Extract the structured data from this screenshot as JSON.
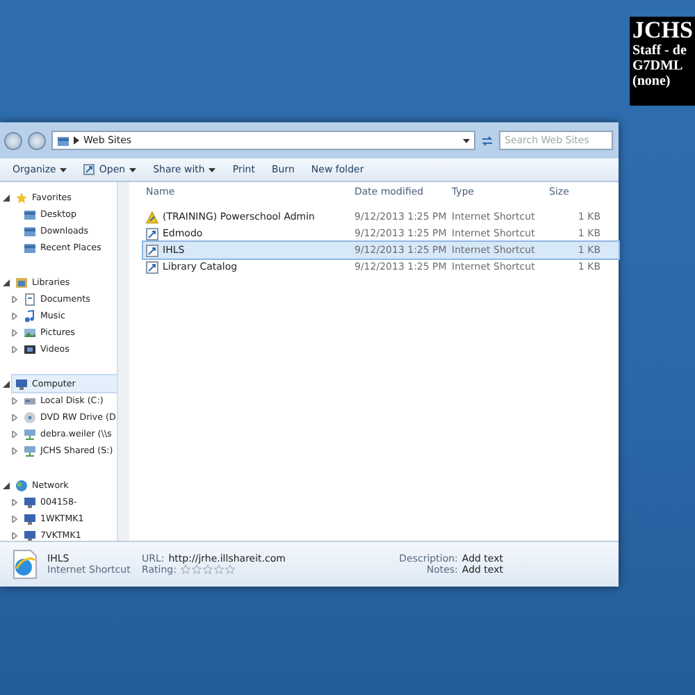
{
  "overlay": {
    "lines": [
      "JCHS",
      "Staff - de",
      "G7DML",
      "(none)"
    ]
  },
  "address_bar": {
    "crumbs": [
      "Web Sites"
    ],
    "search_placeholder": "Search Web Sites"
  },
  "toolbar": [
    {
      "label": "Organize",
      "dropdown": true
    },
    {
      "label": "Open",
      "dropdown": true
    },
    {
      "label": "Share with",
      "dropdown": true
    },
    {
      "label": "Print",
      "dropdown": false
    },
    {
      "label": "Burn",
      "dropdown": false
    },
    {
      "label": "New folder",
      "dropdown": false
    }
  ],
  "sidebar": {
    "groups": [
      {
        "label": "Favorites",
        "expanded": true,
        "selected": false,
        "children": [
          {
            "label": "Desktop",
            "selected": false
          },
          {
            "label": "Downloads",
            "selected": false
          },
          {
            "label": "Recent Places",
            "selected": false
          }
        ]
      },
      {
        "label": "Libraries",
        "expanded": true,
        "selected": false,
        "children": [
          {
            "label": "Documents",
            "expanded": false,
            "selected": false
          },
          {
            "label": "Music",
            "expanded": false,
            "selected": false
          },
          {
            "label": "Pictures",
            "expanded": false,
            "selected": false
          },
          {
            "label": "Videos",
            "expanded": false,
            "selected": false
          }
        ]
      },
      {
        "label": "Computer",
        "expanded": true,
        "selected": true,
        "children": [
          {
            "label": "Local Disk (C:)",
            "expanded": false,
            "selected": false
          },
          {
            "label": "DVD RW Drive (D",
            "expanded": false,
            "selected": false
          },
          {
            "label": "debra.weiler (\\\\s",
            "expanded": false,
            "selected": false
          },
          {
            "label": "JCHS Shared (S:)",
            "expanded": false,
            "selected": false
          }
        ]
      },
      {
        "label": "Network",
        "expanded": true,
        "selected": false,
        "children": [
          {
            "label": "004158-",
            "expanded": false,
            "selected": false
          },
          {
            "label": "1WKTMK1",
            "expanded": false,
            "selected": false
          },
          {
            "label": "7VKTMK1",
            "expanded": false,
            "selected": false
          }
        ]
      }
    ]
  },
  "table": {
    "columns": [
      "Name",
      "Date modified",
      "Type",
      "Size"
    ],
    "rows": [
      {
        "name": "(TRAINING) Powerschool Admin",
        "date": "9/12/2013 1:25 PM",
        "type": "Internet Shortcut",
        "size": "1 KB",
        "kind": "warning",
        "selected": false
      },
      {
        "name": "Edmodo",
        "date": "9/12/2013 1:25 PM",
        "type": "Internet Shortcut",
        "size": "1 KB",
        "kind": "link",
        "selected": false
      },
      {
        "name": "IHLS",
        "date": "9/12/2013 1:25 PM",
        "type": "Internet Shortcut",
        "size": "1 KB",
        "kind": "link",
        "selected": true
      },
      {
        "name": "Library Catalog",
        "date": "9/12/2013 1:25 PM",
        "type": "Internet Shortcut",
        "size": "1 KB",
        "kind": "link",
        "selected": false
      }
    ]
  },
  "details": {
    "title": "IHLS",
    "subtitle": "Internet Shortcut",
    "url_label": "URL:",
    "url": "http://jrhe.illshareit.com",
    "rating_label": "Rating:",
    "stars": 0,
    "description_label": "Description:",
    "description": "Add text",
    "notes_label": "Notes:",
    "notes": "Add text"
  }
}
